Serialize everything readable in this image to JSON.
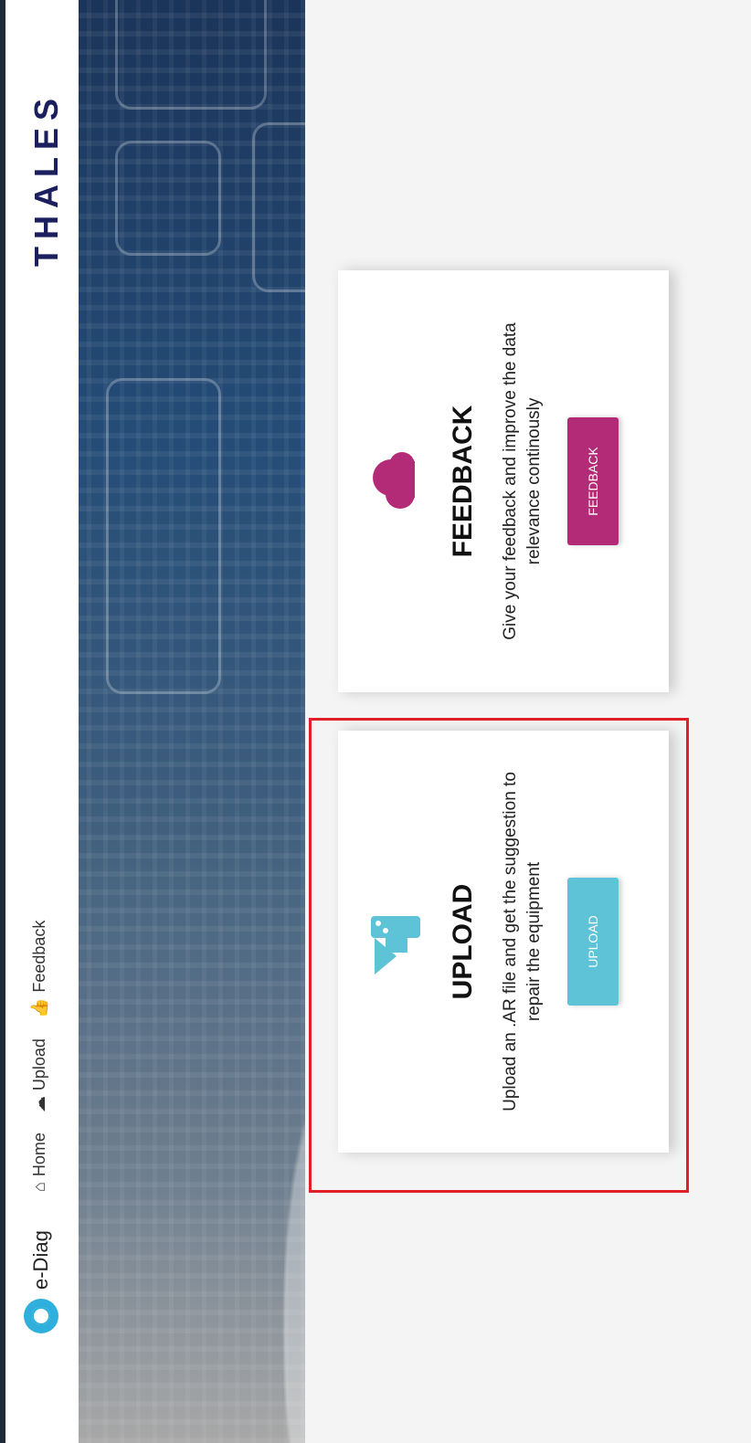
{
  "header": {
    "brand": "e-Diag",
    "nav": [
      {
        "label": "Home",
        "icon": "home-icon"
      },
      {
        "label": "Upload",
        "icon": "cloud-upload-icon"
      },
      {
        "label": "Feedback",
        "icon": "thumbs-up-icon"
      }
    ],
    "logo": "THALES"
  },
  "cards": [
    {
      "title": "UPLOAD",
      "description": "Upload an .AR file and get the suggestion to repair the equipment",
      "button": "UPLOAD",
      "icon": "upload-server-icon",
      "color": "#5ec3d6"
    },
    {
      "title": "FEEDBACK",
      "description": "Give your feedback and improve the data relevance continously",
      "button": "FEEDBACK",
      "icon": "cloud-icon",
      "color": "#b32b76"
    }
  ],
  "colors": {
    "upload_accent": "#5ec3d6",
    "feedback_accent": "#b32b76",
    "logo_color": "#1b1f5e",
    "brand_icon": "#2fb0dc",
    "highlight": "#e01f2a"
  }
}
